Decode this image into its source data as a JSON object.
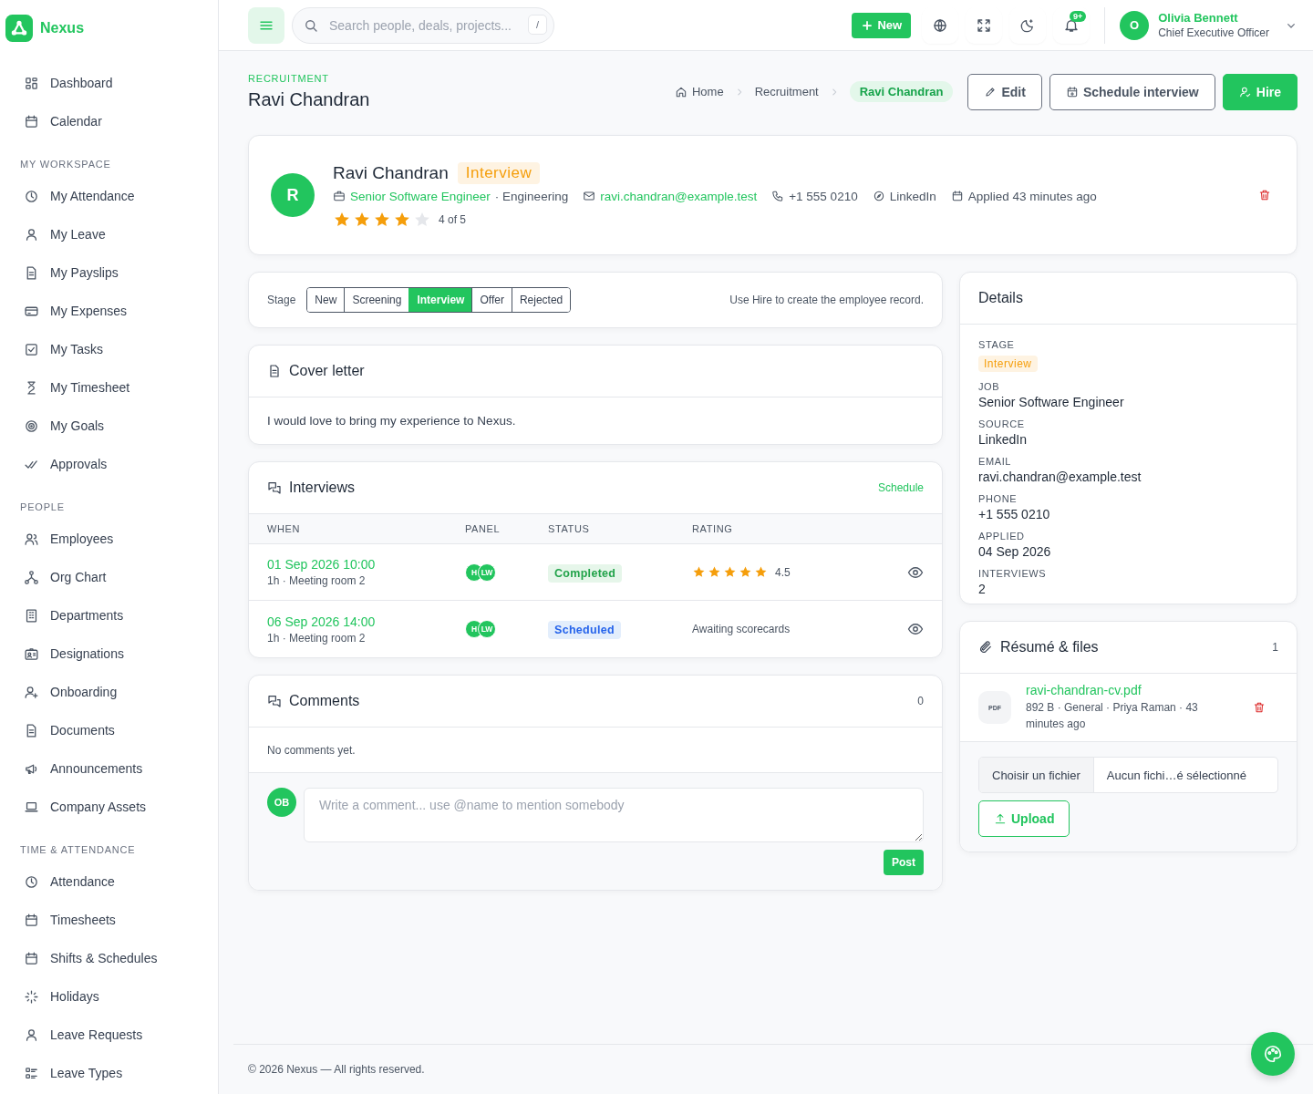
{
  "brand": {
    "name": "Nexus"
  },
  "sidebar": {
    "groups": [
      {
        "items": [
          {
            "label": "Dashboard"
          },
          {
            "label": "Calendar"
          }
        ]
      },
      {
        "heading": "MY WORKSPACE",
        "items": [
          {
            "label": "My Attendance"
          },
          {
            "label": "My Leave"
          },
          {
            "label": "My Payslips"
          },
          {
            "label": "My Expenses"
          },
          {
            "label": "My Tasks"
          },
          {
            "label": "My Timesheet"
          },
          {
            "label": "My Goals"
          },
          {
            "label": "Approvals"
          }
        ]
      },
      {
        "heading": "PEOPLE",
        "items": [
          {
            "label": "Employees"
          },
          {
            "label": "Org Chart"
          },
          {
            "label": "Departments"
          },
          {
            "label": "Designations"
          },
          {
            "label": "Onboarding"
          },
          {
            "label": "Documents"
          },
          {
            "label": "Announcements"
          },
          {
            "label": "Company Assets"
          }
        ]
      },
      {
        "heading": "TIME & ATTENDANCE",
        "items": [
          {
            "label": "Attendance"
          },
          {
            "label": "Timesheets"
          },
          {
            "label": "Shifts & Schedules"
          },
          {
            "label": "Holidays"
          },
          {
            "label": "Leave Requests"
          },
          {
            "label": "Leave Types"
          }
        ]
      }
    ]
  },
  "topbar": {
    "search_placeholder": "Search people, deals, projects...",
    "shortcut": "/",
    "new_button": "New",
    "notification_badge": "9+",
    "user": {
      "initial": "O",
      "name": "Olivia Bennett",
      "role": "Chief Executive Officer"
    }
  },
  "page": {
    "eyebrow": "RECRUITMENT",
    "title": "Ravi Chandran",
    "breadcrumbs": [
      {
        "label": "Home",
        "selected": false
      },
      {
        "label": "Recruitment",
        "selected": false
      },
      {
        "label": "Ravi Chandran",
        "selected": true
      }
    ],
    "actions": [
      {
        "label": "Edit",
        "kind": "outline"
      },
      {
        "label": "Schedule interview",
        "kind": "outline"
      },
      {
        "label": "Hire",
        "kind": "primary"
      }
    ]
  },
  "candidate": {
    "initial": "R",
    "name": "Ravi Chandran",
    "stage": "Interview",
    "job": "Senior Software Engineer",
    "department": "· Engineering",
    "email": "ravi.chandran@example.test",
    "phone": "+1 555 0210",
    "source": "LinkedIn",
    "applied": "Applied 43 minutes ago",
    "stars": 4,
    "rating_text": "4 of 5"
  },
  "stage_bar": {
    "label": "Stage",
    "stages": [
      {
        "label": "New",
        "selected": false
      },
      {
        "label": "Screening",
        "selected": false
      },
      {
        "label": "Interview",
        "selected": true
      },
      {
        "label": "Offer",
        "selected": false
      },
      {
        "label": "Rejected",
        "selected": false
      }
    ],
    "hint": "Use Hire to create the employee record."
  },
  "cover_letter": {
    "title": "Cover letter",
    "text": "I would love to bring my experience to Nexus."
  },
  "interviews": {
    "title": "Interviews",
    "action": "Schedule",
    "columns": [
      "WHEN",
      "PANEL",
      "STATUS",
      "RATING"
    ],
    "rows": [
      {
        "when": "01 Sep 2026 10:00",
        "meta": "1h · Meeting room 2",
        "panel": [
          "H",
          "LW"
        ],
        "status": {
          "label": "Completed",
          "kind": "completed"
        },
        "kind": "stars",
        "stars": 5,
        "rating": "4.5"
      },
      {
        "when": "06 Sep 2026 14:00",
        "meta": "1h · Meeting room 2",
        "panel": [
          "H",
          "LW"
        ],
        "status": {
          "label": "Scheduled",
          "kind": "scheduled"
        },
        "kind": "text",
        "rating": "Awaiting scorecards"
      }
    ]
  },
  "comments": {
    "title": "Comments",
    "count": "0",
    "empty": "No comments yet.",
    "avatar": "OB",
    "placeholder": "Write a comment... use @name to mention somebody",
    "post": "Post"
  },
  "details": {
    "title": "Details",
    "fields": [
      {
        "label": "STAGE",
        "value": "Interview",
        "kind": "badge"
      },
      {
        "label": "JOB",
        "value": "Senior Software Engineer",
        "kind": "text"
      },
      {
        "label": "SOURCE",
        "value": "LinkedIn",
        "kind": "text"
      },
      {
        "label": "EMAIL",
        "value": "ravi.chandran@example.test",
        "kind": "text"
      },
      {
        "label": "PHONE",
        "value": "+1 555 0210",
        "kind": "text"
      },
      {
        "label": "APPLIED",
        "value": "04 Sep 2026",
        "kind": "text"
      },
      {
        "label": "INTERVIEWS",
        "value": "2",
        "kind": "text"
      }
    ]
  },
  "files": {
    "title": "Résumé & files",
    "count": "1",
    "items": [
      {
        "name": "ravi-chandran-cv.pdf",
        "type": "PDF",
        "meta": "892 B · General · Priya Raman · 43 minutes ago"
      }
    ],
    "choose_button": "Choisir un fichier",
    "file_status": "Aucun fichi…é sélectionné",
    "upload": "Upload"
  },
  "footer": "© 2026 Nexus — All rights reserved."
}
